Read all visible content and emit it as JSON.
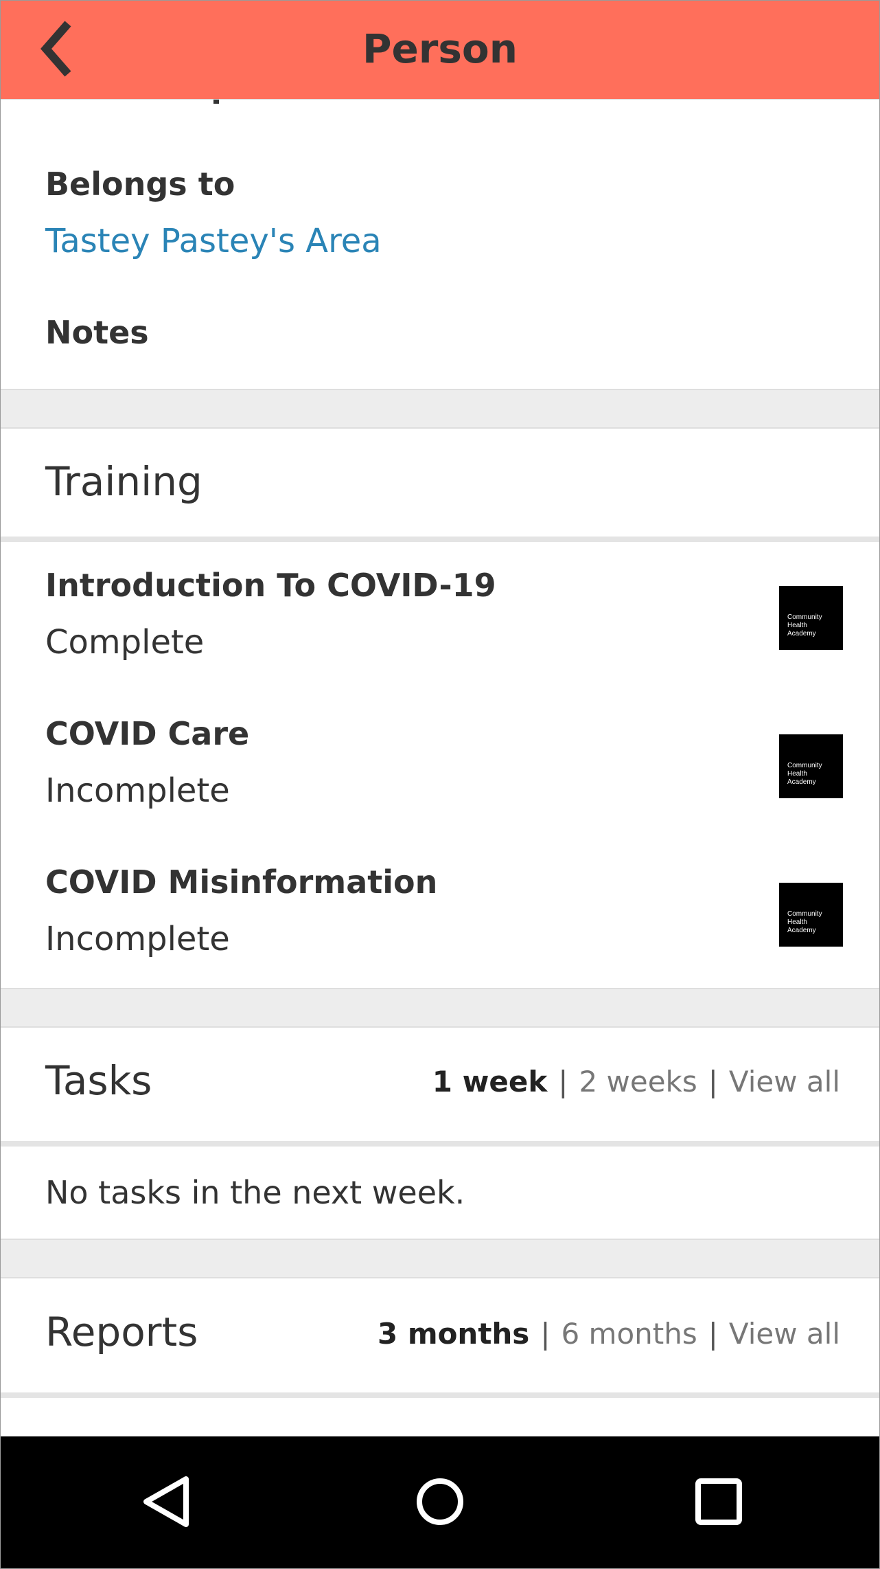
{
  "header": {
    "title": "Person"
  },
  "details": {
    "belongs_to_label": "Belongs to",
    "belongs_to_value": "Tastey Pastey's Area",
    "notes_label": "Notes"
  },
  "training": {
    "title": "Training",
    "items": [
      {
        "title": "Introduction To COVID-19",
        "status": "Complete",
        "logo_lines": [
          "Community",
          "Health",
          "Academy"
        ]
      },
      {
        "title": "COVID Care",
        "status": "Incomplete",
        "logo_lines": [
          "Community",
          "Health",
          "Academy"
        ]
      },
      {
        "title": "COVID Misinformation",
        "status": "Incomplete",
        "logo_lines": [
          "Community",
          "Health",
          "Academy"
        ]
      }
    ]
  },
  "tasks": {
    "title": "Tasks",
    "filters": [
      "1 week",
      "2 weeks",
      "View all"
    ],
    "selected_filter": "1 week",
    "empty_message": "No tasks in the next week."
  },
  "reports": {
    "title": "Reports",
    "filters": [
      "3 months",
      "6 months",
      "View all"
    ],
    "selected_filter": "3 months"
  },
  "colors": {
    "header_bg": "#ff6f5b",
    "link": "#2a84b6",
    "section_gap": "#ededed"
  },
  "icons": {
    "back": "chevron-left-icon",
    "nav_back": "triangle-back-icon",
    "nav_home": "circle-home-icon",
    "nav_recents": "square-recents-icon"
  }
}
